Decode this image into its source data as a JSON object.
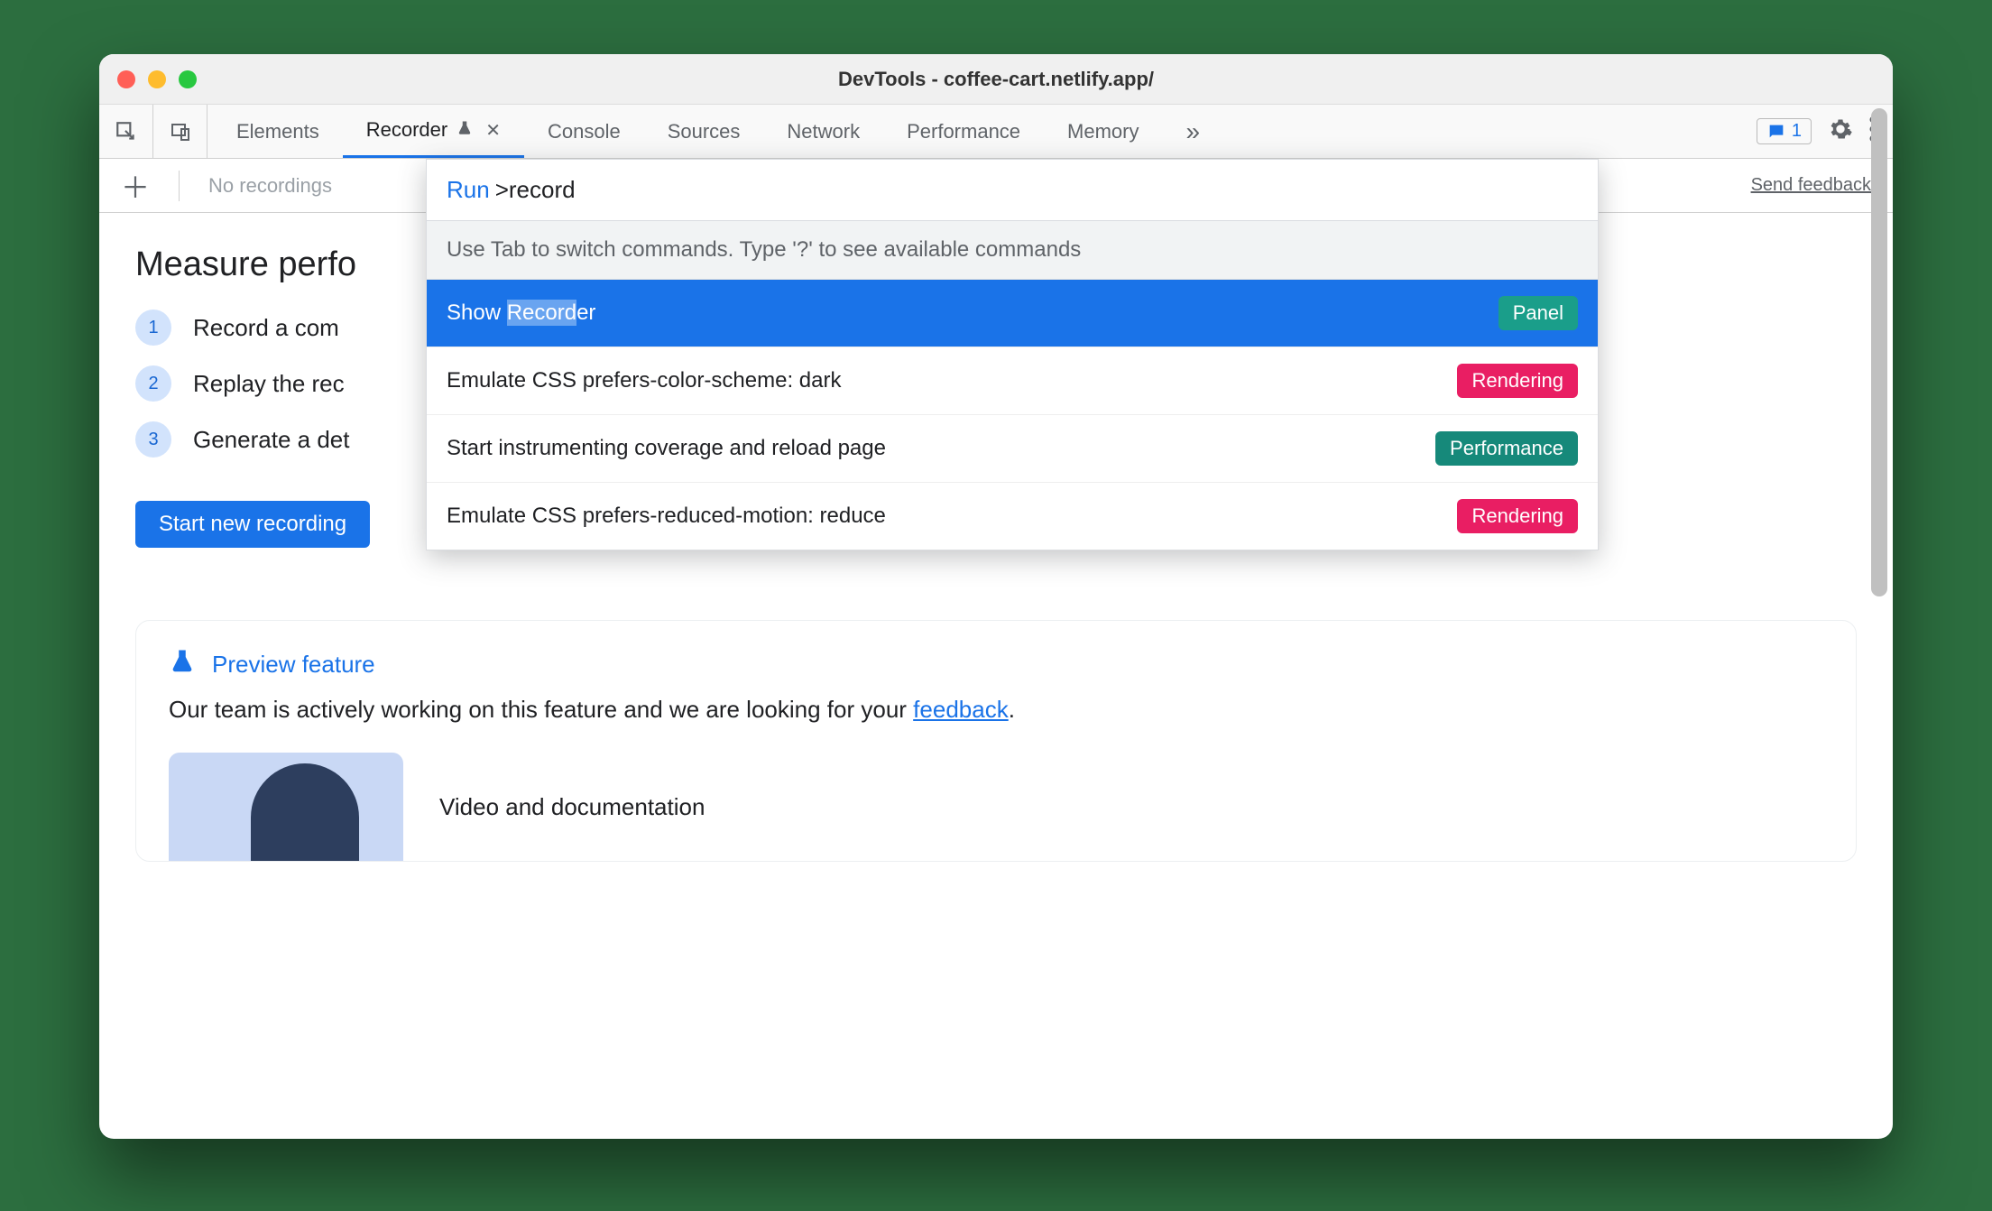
{
  "window": {
    "title": "DevTools - coffee-cart.netlify.app/"
  },
  "tabs": {
    "elements": "Elements",
    "recorder": "Recorder",
    "console": "Console",
    "sources": "Sources",
    "network": "Network",
    "performance": "Performance",
    "memory": "Memory"
  },
  "message_count": "1",
  "subbar": {
    "no_recordings": "No recordings",
    "send_feedback": "Send feedback"
  },
  "main": {
    "heading": "Measure perfo",
    "steps": [
      "Record a com",
      "Replay the rec",
      "Generate a det"
    ],
    "start_btn": "Start new recording"
  },
  "preview": {
    "title": "Preview feature",
    "body_pre": "Our team is actively working on this feature and we are looking for your ",
    "feedback_link": "feedback",
    "body_post": ".",
    "media_title": "Video and documentation"
  },
  "cmd": {
    "run_label": "Run",
    "chevron": ">",
    "query": "record",
    "hint": "Use Tab to switch commands. Type '?' to see available commands",
    "items": [
      {
        "pre": "Show ",
        "hl": "Record",
        "post": "er",
        "badge": "Panel",
        "badgeColor": "teal",
        "selected": true
      },
      {
        "text": "Emulate CSS prefers-color-scheme: dark",
        "badge": "Rendering",
        "badgeColor": "pink"
      },
      {
        "text": "Start instrumenting coverage and reload page",
        "badge": "Performance",
        "badgeColor": "teal-dark"
      },
      {
        "text": "Emulate CSS prefers-reduced-motion: reduce",
        "badge": "Rendering",
        "badgeColor": "pink"
      }
    ]
  }
}
